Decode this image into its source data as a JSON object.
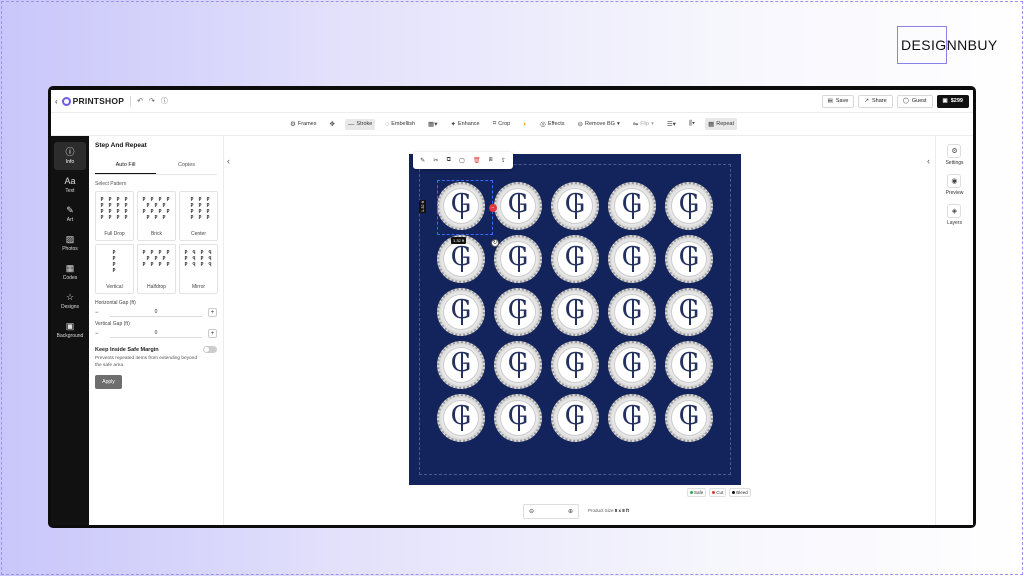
{
  "brand": {
    "name": "DESIGNNBUY"
  },
  "topbar": {
    "logo": "PRINTSHOP",
    "undo_icon": "undo-icon",
    "redo_icon": "redo-icon",
    "help_icon": "help-icon",
    "save": "Save",
    "share": "Share",
    "guest": "Guest",
    "price": "$299"
  },
  "toolbar": {
    "frames": "Frames",
    "stroke": "Stroke",
    "embellish": "Embellish",
    "enhance": "Enhance",
    "crop": "Crop",
    "effects": "Effects",
    "remove_bg": "Remove BG",
    "flip": "Flip",
    "repeat": "Repeat"
  },
  "rail": [
    {
      "label": "Info",
      "icon": "info-icon",
      "glyph": "ⓘ"
    },
    {
      "label": "Text",
      "icon": "text-icon",
      "glyph": "Aa"
    },
    {
      "label": "Art",
      "icon": "art-icon",
      "glyph": "✎"
    },
    {
      "label": "Photos",
      "icon": "photos-icon",
      "glyph": "▨"
    },
    {
      "label": "Codes",
      "icon": "qr-code-icon",
      "glyph": "▦"
    },
    {
      "label": "Designs",
      "icon": "star-icon",
      "glyph": "☆"
    },
    {
      "label": "Background",
      "icon": "background-icon",
      "glyph": "▣"
    }
  ],
  "panel": {
    "title": "Step And Repeat",
    "tabs": [
      "Auto Fill",
      "Copies"
    ],
    "select_pattern": "Select Pattern",
    "patterns": [
      {
        "name": "Full Drop",
        "preview": "P P P P\nP P P P\nP P P P\nP P P P"
      },
      {
        "name": "Brick",
        "preview": "P P P P\n P P P \nP P P P\n P P P "
      },
      {
        "name": "Center",
        "preview": " P P P\n P P P\n P P P\n P P P"
      },
      {
        "name": "Vertical",
        "preview": "P\nP\nP\nP"
      },
      {
        "name": "Halfdrop",
        "preview": "P P P P\n P P P \nP P P P"
      },
      {
        "name": "Mirror",
        "preview": "P ꟼ P ꟼ\nP ꟼ P ꟼ\nP ꟼ P ꟼ"
      }
    ],
    "horizontal_gap_label": "Horizontal Gap (ft)",
    "horizontal_gap": "0",
    "vertical_gap_label": "Vertical Gap (ft)",
    "vertical_gap": "0",
    "safe_margin_title": "Keep Inside Safe Margin",
    "safe_margin_desc": "Prevents repeated items from extending beyond the safe area.",
    "apply": "Apply"
  },
  "canvas": {
    "width_tag": "1.32 ft",
    "height_tag": "1.32 ft",
    "rows": 5,
    "cols": 5,
    "medallion_letter": "G"
  },
  "legend": [
    {
      "label": "Safe",
      "color": "#2faa4a"
    },
    {
      "label": "Cut",
      "color": "#e23a3a"
    },
    {
      "label": "Bleed",
      "color": "#111111"
    }
  ],
  "bottom": {
    "product_size_label": "Product Size",
    "product_size_value": "8 x 8 ft"
  },
  "right_rail": [
    {
      "label": "Settings",
      "icon": "gear-icon",
      "glyph": "⚙"
    },
    {
      "label": "Preview",
      "icon": "eye-icon",
      "glyph": "◉"
    },
    {
      "label": "Layers",
      "icon": "layers-icon",
      "glyph": "◈"
    }
  ]
}
